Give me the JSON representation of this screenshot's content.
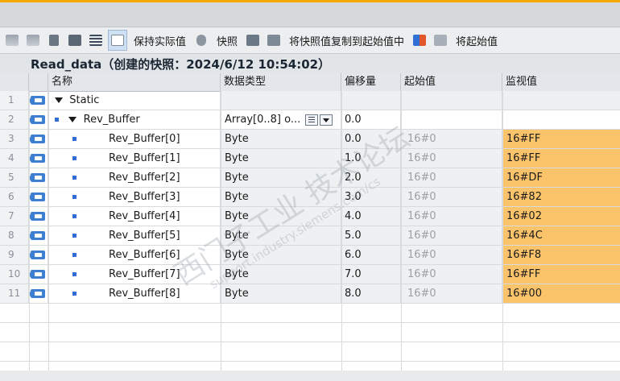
{
  "toolbar": {
    "keep_actual": "保持实际值",
    "snapshot": "快照",
    "copy_snapshot_to_start": "将快照值复制到起始值中",
    "load_start": "将起始值"
  },
  "block": {
    "title": "Read_data（创建的快照：2024/6/12 10:54:02）"
  },
  "columns": {
    "name": "名称",
    "type": "数据类型",
    "offset": "偏移量",
    "start": "起始值",
    "monitor": "监视值"
  },
  "rows": [
    {
      "num": "1",
      "name": "Static",
      "type": "",
      "offset": "",
      "start": "",
      "monitor": ""
    },
    {
      "num": "2",
      "name": "Rev_Buffer",
      "type": "Array[0..8] o...",
      "offset": "0.0",
      "start": "",
      "monitor": ""
    },
    {
      "num": "3",
      "name": "Rev_Buffer[0]",
      "type": "Byte",
      "offset": "0.0",
      "start": "16#0",
      "monitor": "16#FF"
    },
    {
      "num": "4",
      "name": "Rev_Buffer[1]",
      "type": "Byte",
      "offset": "1.0",
      "start": "16#0",
      "monitor": "16#FF"
    },
    {
      "num": "5",
      "name": "Rev_Buffer[2]",
      "type": "Byte",
      "offset": "2.0",
      "start": "16#0",
      "monitor": "16#DF"
    },
    {
      "num": "6",
      "name": "Rev_Buffer[3]",
      "type": "Byte",
      "offset": "3.0",
      "start": "16#0",
      "monitor": "16#82"
    },
    {
      "num": "7",
      "name": "Rev_Buffer[4]",
      "type": "Byte",
      "offset": "4.0",
      "start": "16#0",
      "monitor": "16#02"
    },
    {
      "num": "8",
      "name": "Rev_Buffer[5]",
      "type": "Byte",
      "offset": "5.0",
      "start": "16#0",
      "monitor": "16#4C"
    },
    {
      "num": "9",
      "name": "Rev_Buffer[6]",
      "type": "Byte",
      "offset": "6.0",
      "start": "16#0",
      "monitor": "16#F8"
    },
    {
      "num": "10",
      "name": "Rev_Buffer[7]",
      "type": "Byte",
      "offset": "7.0",
      "start": "16#0",
      "monitor": "16#FF"
    },
    {
      "num": "11",
      "name": "Rev_Buffer[8]",
      "type": "Byte",
      "offset": "8.0",
      "start": "16#0",
      "monitor": "16#00"
    }
  ],
  "watermark": {
    "main": "西门子工业 技术论坛",
    "sub": "support.industry.siemens.com/cs"
  },
  "colors": {
    "monitor_bg": "#fbc46b",
    "port_icon": "#3d7fd0",
    "accent": "#f2a900"
  }
}
